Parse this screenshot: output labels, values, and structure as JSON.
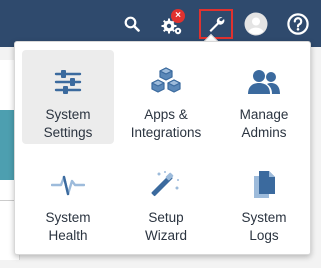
{
  "header": {
    "icons": [
      "search-icon",
      "gears-icon",
      "wrench-icon",
      "avatar-icon",
      "help-icon"
    ],
    "notification_badge": "×"
  },
  "menu": {
    "items": [
      {
        "line1": "System",
        "line2": "Settings",
        "icon": "sliders-icon",
        "selected": true
      },
      {
        "line1": "Apps &",
        "line2": "Integrations",
        "icon": "cubes-icon"
      },
      {
        "line1": "Manage",
        "line2": "Admins",
        "icon": "users-icon"
      },
      {
        "line1": "System",
        "line2": "Health",
        "icon": "heartbeat-icon"
      },
      {
        "line1": "Setup",
        "line2": "Wizard",
        "icon": "magic-wand-icon"
      },
      {
        "line1": "System",
        "line2": "Logs",
        "icon": "files-icon"
      }
    ]
  },
  "colors": {
    "header_bg": "#2f4a6d",
    "icon_blue": "#3b6a9e",
    "highlight_red": "#e0322f",
    "tile_selected_bg": "#ececec"
  }
}
